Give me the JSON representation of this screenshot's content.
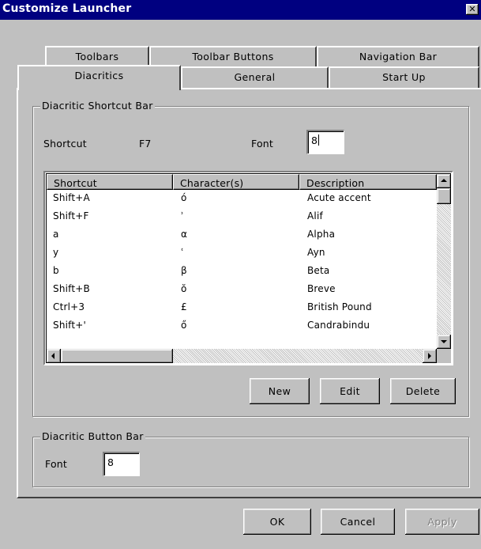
{
  "window": {
    "title": "Customize Launcher",
    "close_glyph": "✕"
  },
  "tabs": {
    "back_row": [
      "Toolbars",
      "Toolbar Buttons",
      "Navigation Bar"
    ],
    "front_row": [
      "Diacritics",
      "General",
      "Start Up"
    ],
    "active": "Diacritics"
  },
  "shortcut_bar": {
    "legend": "Diacritic Shortcut Bar",
    "shortcut_label": "Shortcut",
    "shortcut_value": "F7",
    "font_label": "Font",
    "font_value": "8"
  },
  "table": {
    "columns": [
      "Shortcut",
      "Character(s)",
      "Description"
    ],
    "rows": [
      {
        "shortcut": "Shift+A",
        "chars": "ó",
        "description": "Acute accent"
      },
      {
        "shortcut": "Shift+F",
        "chars": "ʾ",
        "description": "Alif"
      },
      {
        "shortcut": "a",
        "chars": "α",
        "description": "Alpha"
      },
      {
        "shortcut": "y",
        "chars": "ʿ",
        "description": "Ayn"
      },
      {
        "shortcut": "b",
        "chars": "β",
        "description": "Beta"
      },
      {
        "shortcut": "Shift+B",
        "chars": "ŏ",
        "description": "Breve"
      },
      {
        "shortcut": "Ctrl+3",
        "chars": "£",
        "description": "British Pound"
      },
      {
        "shortcut": "Shift+'",
        "chars": "ő",
        "description": "Candrabindu"
      }
    ]
  },
  "list_actions": {
    "new": "New",
    "edit": "Edit",
    "delete": "Delete"
  },
  "button_bar": {
    "legend": "Diacritic Button Bar",
    "font_label": "Font",
    "font_value": "8"
  },
  "dialog_buttons": {
    "ok": "OK",
    "cancel": "Cancel",
    "apply": "Apply"
  },
  "colors": {
    "title_bar": "#000080",
    "face": "#c0c0c0",
    "disabled_text": "#808080"
  }
}
